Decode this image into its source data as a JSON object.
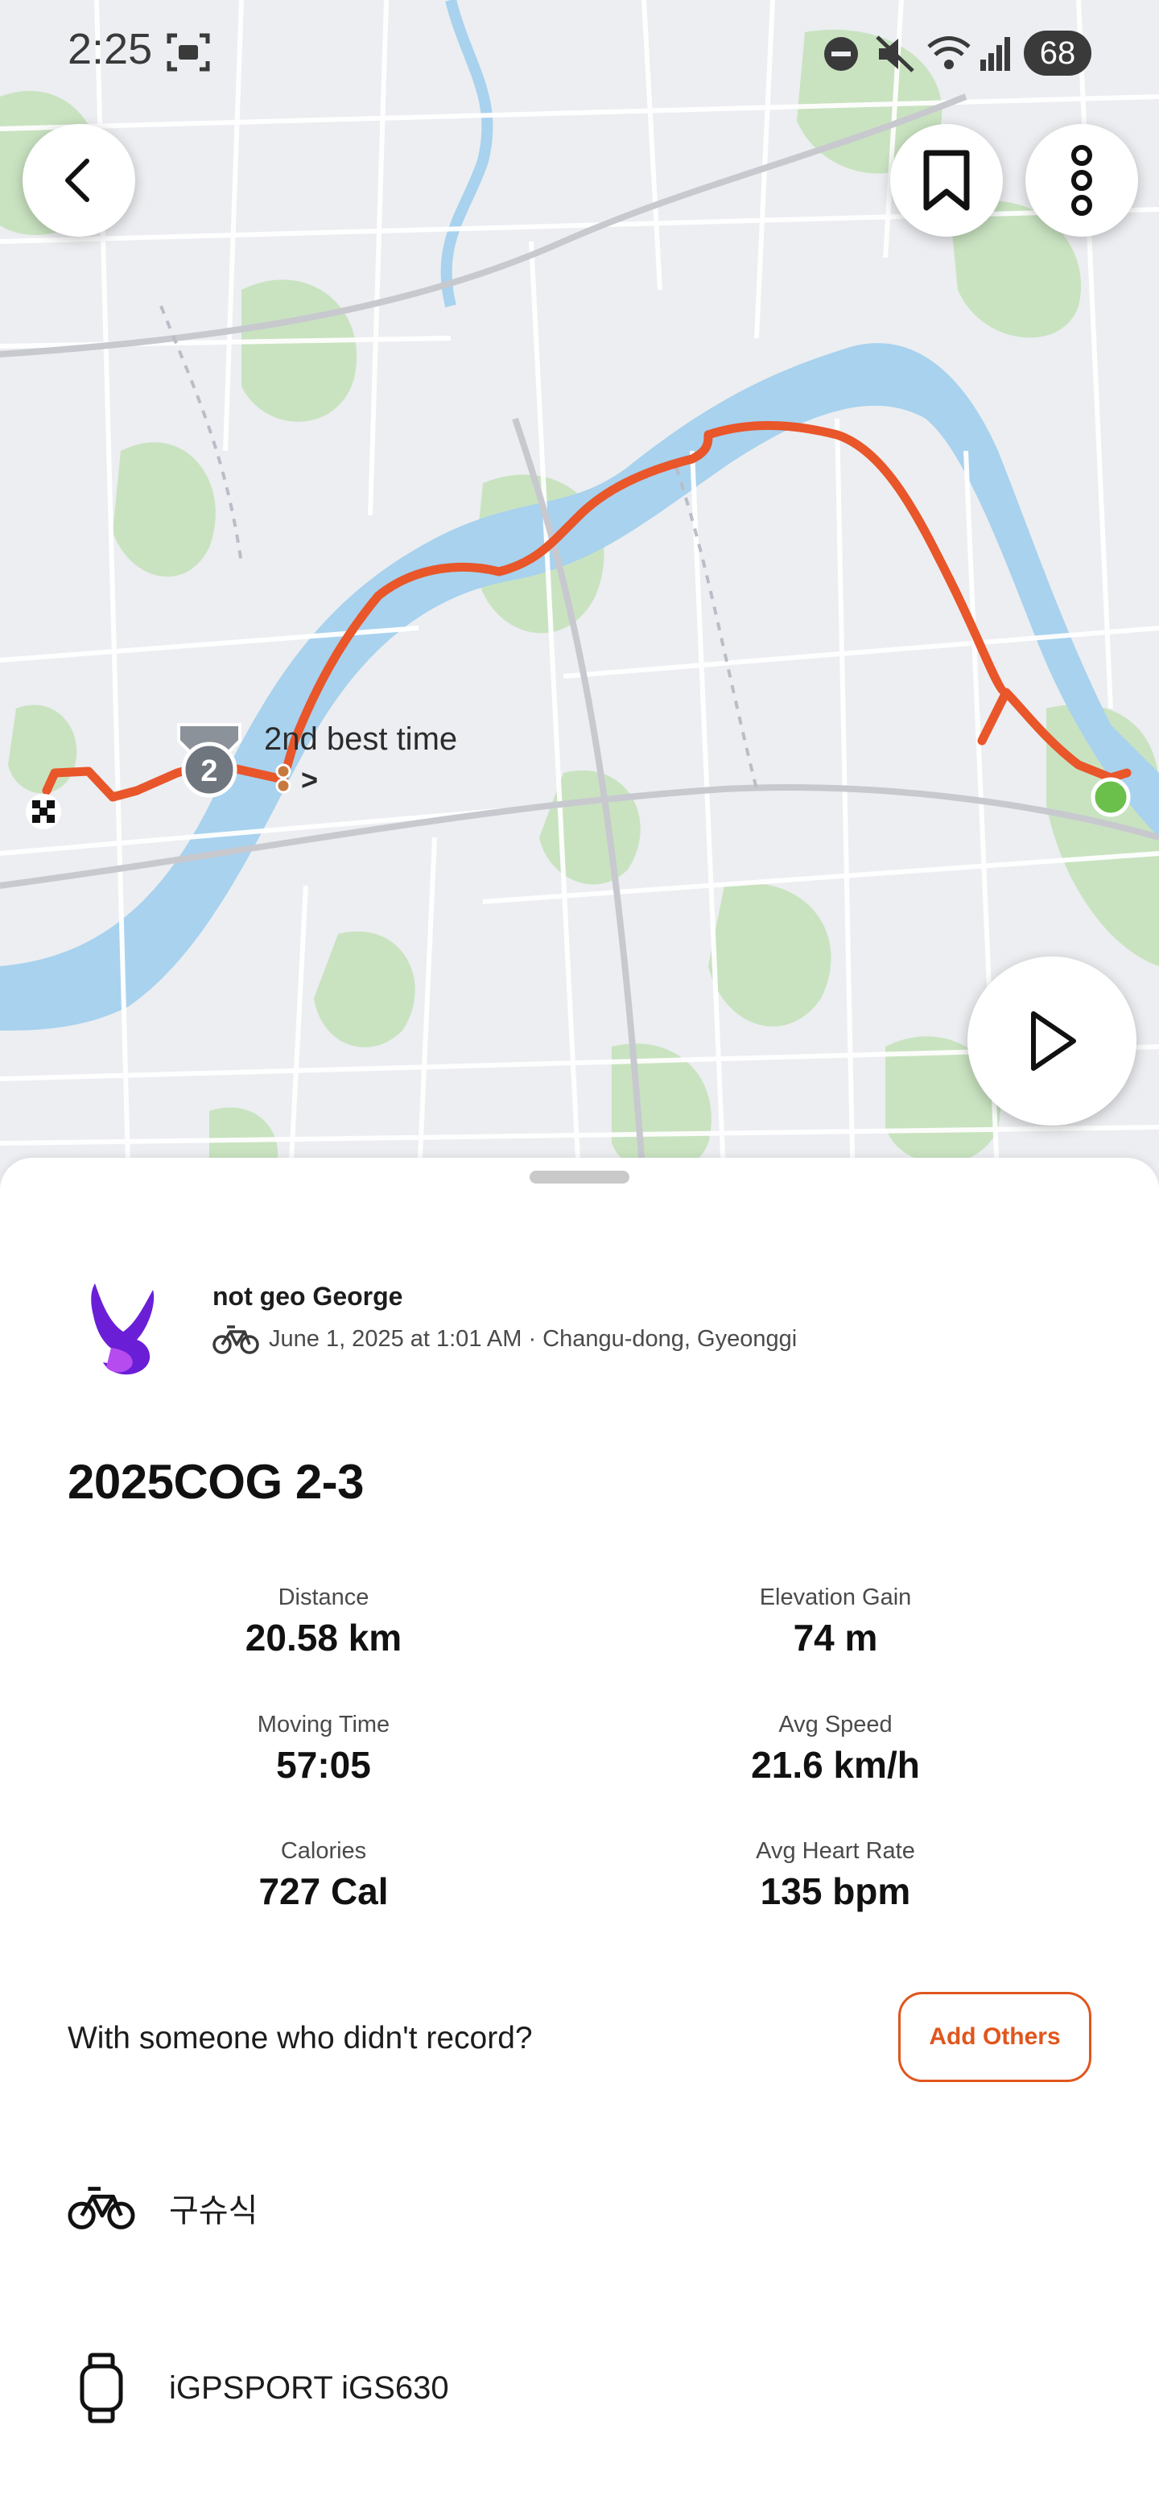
{
  "status_bar": {
    "time": "2:25",
    "battery": "68",
    "icons": [
      "screenshot-icon",
      "dnd-icon",
      "mute-icon",
      "wifi-icon",
      "signal-icon"
    ]
  },
  "map": {
    "achievement_label": "2nd best time",
    "achievement_chevron": ">",
    "medal_rank": "2",
    "route_color": "#e8562a",
    "water_color": "#a8d2ee",
    "park_color": "#c9e3c1"
  },
  "activity": {
    "athlete_name": "not geo George",
    "meta": "June 1, 2025 at 1:01 AM · Changu-dong, Gyeonggi",
    "title": "2025COG 2-3"
  },
  "stats": [
    {
      "label": "Distance",
      "value": "20.58 km"
    },
    {
      "label": "Elevation Gain",
      "value": "74 m"
    },
    {
      "label": "Moving Time",
      "value": "57:05"
    },
    {
      "label": "Avg Speed",
      "value": "21.6 km/h"
    },
    {
      "label": "Calories",
      "value": "727 Cal"
    },
    {
      "label": "Avg Heart Rate",
      "value": "135 bpm"
    }
  ],
  "with_others": {
    "prompt": "With someone who didn't record?",
    "button": "Add Others",
    "accent": "#e0561d"
  },
  "gear": [
    {
      "icon": "bike-icon",
      "label": "구슈식"
    },
    {
      "icon": "watch-icon",
      "label": "iGPSPORT iGS630"
    }
  ]
}
